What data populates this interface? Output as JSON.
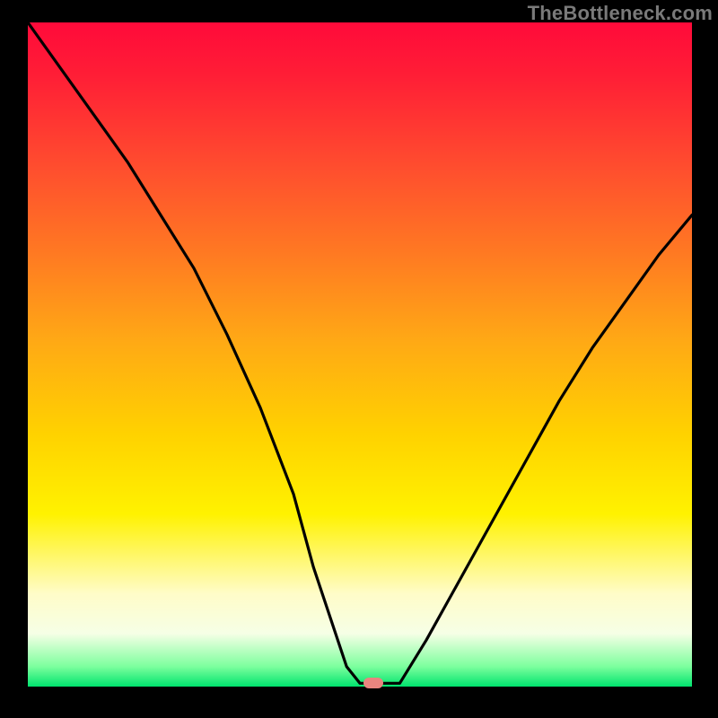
{
  "watermark": "TheBottleneck.com",
  "chart_data": {
    "type": "line",
    "title": "",
    "xlabel": "",
    "ylabel": "",
    "xlim": [
      0,
      100
    ],
    "ylim": [
      0,
      100
    ],
    "x": [
      0,
      5,
      10,
      15,
      20,
      25,
      30,
      35,
      40,
      43,
      48,
      50,
      53,
      56,
      60,
      65,
      70,
      75,
      80,
      85,
      90,
      95,
      100
    ],
    "y": [
      100,
      93,
      86,
      79,
      71,
      63,
      53,
      42,
      29,
      18,
      3,
      0.5,
      0.5,
      0.5,
      7,
      16,
      25,
      34,
      43,
      51,
      58,
      65,
      71
    ],
    "marker": {
      "x": 52,
      "y": 0.5
    },
    "background_gradient": {
      "top": "#ff0a3a",
      "mid": "#ffd200",
      "bottom": "#00e36e"
    }
  }
}
